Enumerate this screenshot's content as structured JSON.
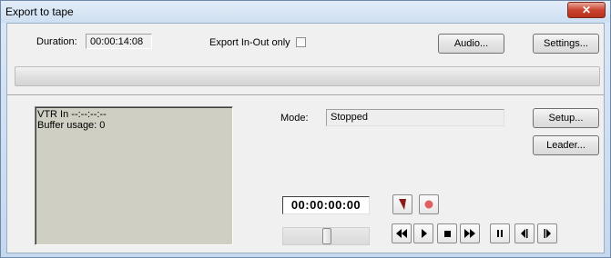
{
  "window": {
    "title": "Export to tape",
    "close_glyph": "✕"
  },
  "top": {
    "duration_label": "Duration:",
    "duration_value": "00:00:14:08",
    "export_inout_label": "Export In-Out only",
    "export_inout_checked": false,
    "audio_button": "Audio...",
    "settings_button": "Settings..."
  },
  "progress": {
    "value": 0
  },
  "status": {
    "line1": "VTR In --:--:--:--",
    "line2": "Buffer usage: 0"
  },
  "mode": {
    "label": "Mode:",
    "value": "Stopped"
  },
  "side_buttons": {
    "setup": "Setup...",
    "leader": "Leader..."
  },
  "transport": {
    "timecode": "00:00:00:00",
    "mark_icon": "mark-flag-icon",
    "record_icon": "record-icon",
    "record_color": "#e06060",
    "rewind_icon": "rewind-icon",
    "play_icon": "play-icon",
    "stop_icon": "stop-icon",
    "fast_forward_icon": "fast-forward-icon",
    "pause_icon": "pause-icon",
    "step_back_icon": "step-back-icon",
    "step_forward_icon": "step-forward-icon",
    "shuttle_position": 0.5
  },
  "colors": {
    "status_box_bg": "#cfcfc4",
    "mark_red": "#8b1a1a"
  }
}
